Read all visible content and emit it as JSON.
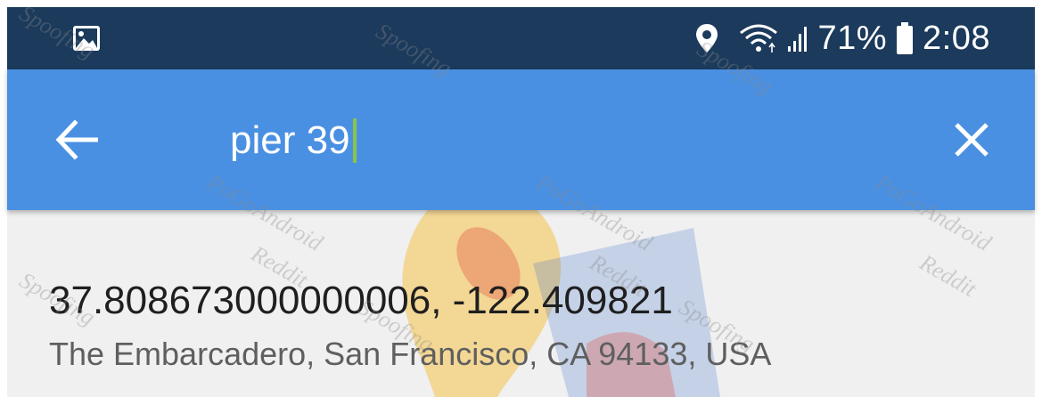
{
  "status_bar": {
    "icons": [
      "image-icon",
      "location-pin-icon",
      "wifi-icon",
      "signal-icon",
      "battery-icon"
    ],
    "battery": "71%",
    "time": "2:08",
    "background_color": "#1b3a5c"
  },
  "search_bar": {
    "query": "pier 39",
    "back_icon": "arrow-left-icon",
    "clear_icon": "close-icon",
    "background_color": "#4a90e2",
    "caret_color": "#8bc34a"
  },
  "results": [
    {
      "title": "37.808673000000006, -122.409821",
      "subtitle": "The Embarcadero, San Francisco, CA 94133, USA"
    }
  ],
  "watermark": {
    "lines": [
      "PoGoAndroid",
      "Reddit",
      "Spoofing"
    ]
  }
}
